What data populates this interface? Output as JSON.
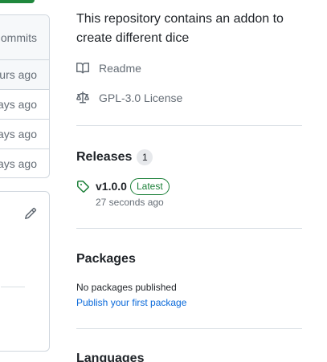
{
  "file_list": {
    "header_text": "ommits",
    "rows": [
      "urs ago",
      "ays ago",
      "ays ago",
      "ays ago"
    ]
  },
  "sidebar": {
    "about": "This repository contains an addon to create different dice",
    "readme_label": "Readme",
    "license_label": "GPL-3.0 License",
    "releases": {
      "title": "Releases",
      "count": "1",
      "latest": {
        "name": "v1.0.0",
        "badge": "Latest",
        "time": "27 seconds ago"
      }
    },
    "packages": {
      "title": "Packages",
      "empty_text": "No packages published",
      "publish_link": "Publish your first package"
    },
    "languages": {
      "title": "Languages"
    }
  },
  "icons": {
    "readme": "book-icon",
    "license": "law-icon",
    "release": "tag-icon",
    "edit": "pencil-icon"
  },
  "colors": {
    "accent_green": "#1f883d",
    "badge_green": "#1a7f37",
    "link_blue": "#0969da",
    "muted": "#656d76",
    "border": "#d0d7de"
  }
}
